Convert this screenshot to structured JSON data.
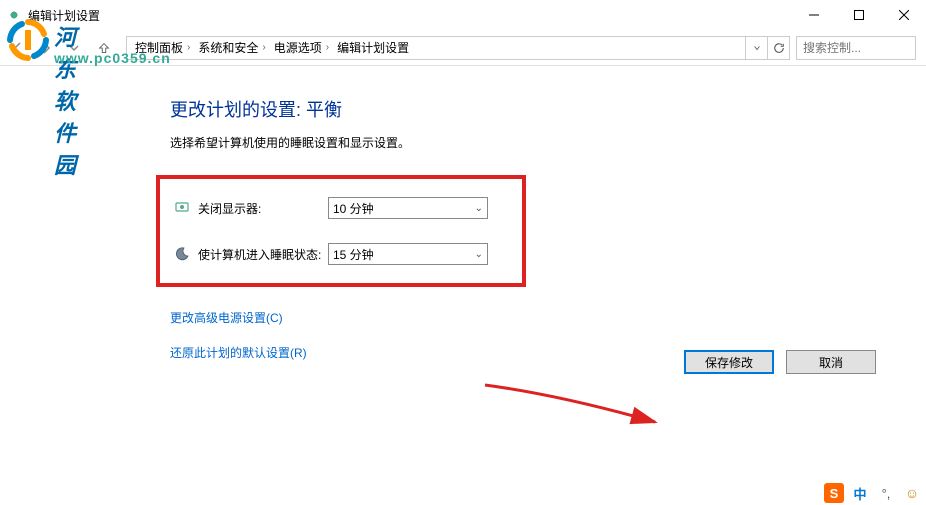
{
  "window": {
    "title": "编辑计划设置"
  },
  "breadcrumb": {
    "items": [
      "控制面板",
      "系统和安全",
      "电源选项",
      "编辑计划设置"
    ]
  },
  "search": {
    "placeholder": "搜索控制..."
  },
  "page": {
    "title": "更改计划的设置: 平衡",
    "description": "选择希望计算机使用的睡眠设置和显示设置。"
  },
  "settings": {
    "display_off": {
      "label": "关闭显示器:",
      "value": "10 分钟"
    },
    "sleep": {
      "label": "使计算机进入睡眠状态:",
      "value": "15 分钟"
    }
  },
  "links": {
    "advanced": "更改高级电源设置(C)",
    "restore": "还原此计划的默认设置(R)"
  },
  "buttons": {
    "save": "保存修改",
    "cancel": "取消"
  },
  "watermark": {
    "text": "河东软件园",
    "url": "www.pc0359.cn"
  },
  "tray": {
    "sogou": "S",
    "ime": "中"
  }
}
